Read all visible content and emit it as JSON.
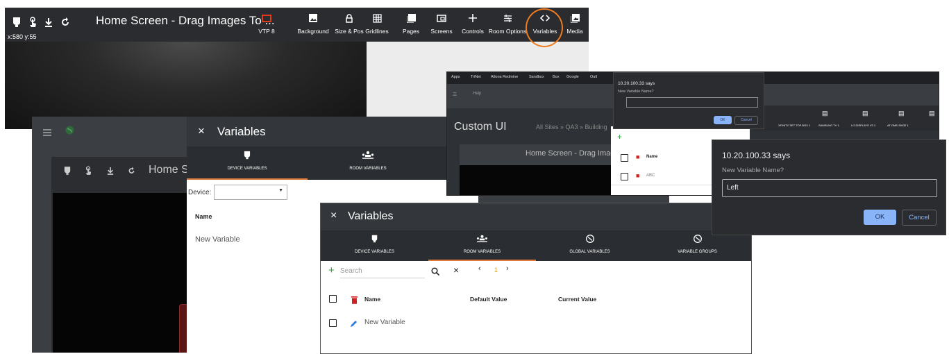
{
  "toolbar": {
    "title": "Home Screen - Drag Images To ...",
    "coords": "x:580 y:55",
    "buttons": [
      {
        "label": "VTP 8",
        "icon": "screen-icon"
      },
      {
        "label": "Background",
        "icon": "image-icon"
      },
      {
        "label": "Size & Pos",
        "icon": "lock-icon"
      },
      {
        "label": "Gridlines",
        "icon": "grid-icon"
      },
      {
        "label": "Pages",
        "icon": "pages-icon"
      },
      {
        "label": "Screens",
        "icon": "screens-icon"
      },
      {
        "label": "Controls",
        "icon": "plus-icon"
      },
      {
        "label": "Room Options",
        "icon": "sliders-icon"
      },
      {
        "label": "Variables",
        "icon": "code-icon"
      },
      {
        "label": "Media",
        "icon": "media-icon"
      }
    ],
    "accent": "#f07b1e"
  },
  "back_window": {
    "title_fragment": "Home S"
  },
  "variables_panel_1": {
    "title": "Variables",
    "tabs": [
      "DEVICE VARIABLES",
      "ROOM VARIABLES"
    ],
    "device_label": "Device:",
    "name_header": "Name",
    "row": "New Variable"
  },
  "variables_panel_2": {
    "title": "Variables",
    "tabs": [
      "DEVICE VARIABLES",
      "ROOM VARIABLES",
      "GLOBAL VARIABLES",
      "VARIABLE GROUPS"
    ],
    "search_placeholder": "Search",
    "page": "1",
    "columns": [
      "Name",
      "Default Value",
      "Current Value"
    ],
    "row": "New Variable"
  },
  "browser": {
    "bookmarks": [
      "Apps",
      "TriNet",
      "Atlona Redmine",
      "Sandbox",
      "Box",
      "Google",
      "Outl"
    ],
    "help": "Help",
    "custom_ui": "Custom UI",
    "breadcrumb": "All Sites » QA3 » Building",
    "inner_title": "Home Screen - Drag Image",
    "name_header": "Name",
    "row": "ABC",
    "devices": [
      "V 1",
      "XFINITY SET TOP BOX 1",
      "SAMSUNG TV 1",
      "LG DISPLAYS V2 1",
      "AT-OME-SW32 1"
    ]
  },
  "dialog_small": {
    "title": "10.20.100.33 says",
    "prompt": "New Variable Name?",
    "ok": "OK",
    "cancel": "Cancel"
  },
  "dialog_large": {
    "title": "10.20.100.33 says",
    "prompt": "New Variable Name?",
    "value": "Left",
    "ok": "OK",
    "cancel": "Cancel"
  }
}
